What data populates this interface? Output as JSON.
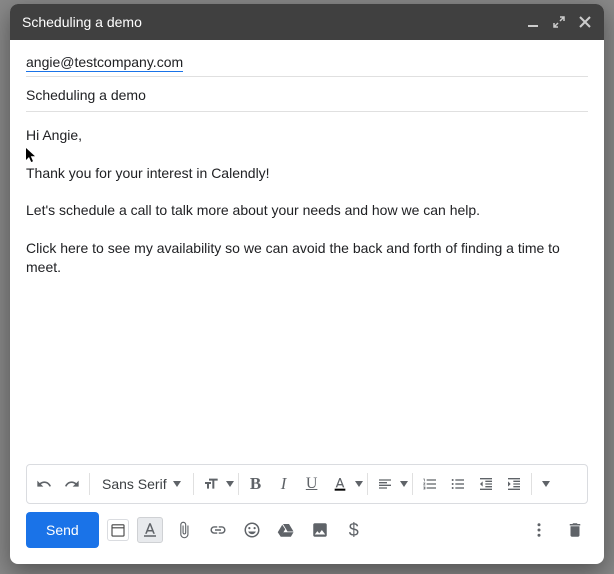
{
  "window": {
    "title": "Scheduling a demo"
  },
  "recipient": "angie@testcompany.com",
  "subject": "Scheduling a demo",
  "body": {
    "p1": "Hi Angie,",
    "p2": "Thank you for your interest in Calendly!",
    "p3": "Let's schedule a call to talk more about your needs and how we can help.",
    "p4": "Click here to see my availability so we can avoid the back and forth of finding a time to meet."
  },
  "format": {
    "font_name": "Sans Serif"
  },
  "actions": {
    "send": "Send"
  }
}
